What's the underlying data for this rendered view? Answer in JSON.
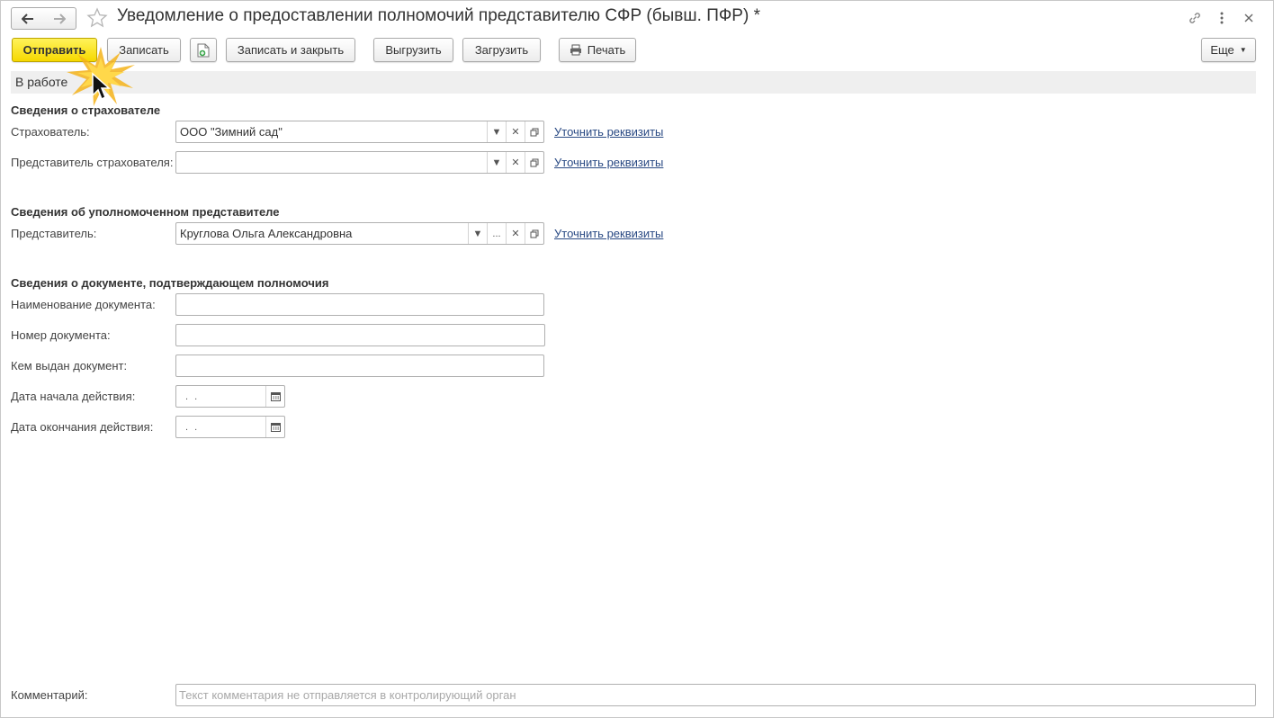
{
  "window": {
    "title": "Уведомление о предоставлении полномочий представителю СФР (бывш. ПФР) *",
    "icons": [
      "back-arrow-icon",
      "forward-arrow-icon",
      "favorite-star-icon",
      "link-icon",
      "more-vertical-icon",
      "close-icon"
    ]
  },
  "toolbar": {
    "send": "Отправить",
    "save": "Записать",
    "save_close": "Записать и закрыть",
    "export": "Выгрузить",
    "import": "Загрузить",
    "print": "Печать",
    "more": "Еще"
  },
  "status": "В работе",
  "insurer_section": {
    "title": "Сведения о страхователе",
    "insurer_label": "Страхователь:",
    "insurer_value": "ООО \"Зимний сад\"",
    "insurer_rep_label": "Представитель страхователя:",
    "insurer_rep_value": "",
    "clarify_link": "Уточнить реквизиты"
  },
  "rep_section": {
    "title": "Сведения об уполномоченном представителе",
    "rep_label": "Представитель:",
    "rep_value": "Круглова Ольга Александровна",
    "rep_select_btn": "...",
    "clarify_link": "Уточнить реквизиты"
  },
  "doc_section": {
    "title": "Сведения о документе, подтверждающем полномочия",
    "doc_name_label": "Наименование документа:",
    "doc_name_value": "",
    "doc_number_label": "Номер документа:",
    "doc_number_value": "",
    "issued_by_label": "Кем выдан документ:",
    "issued_by_value": "",
    "start_date_label": "Дата начала действия:",
    "start_date_value": " .  .",
    "end_date_label": "Дата окончания действия:",
    "end_date_value": " .  ."
  },
  "comment": {
    "label": "Комментарий:",
    "placeholder": "Текст комментария не отправляется в контролирующий орган"
  }
}
